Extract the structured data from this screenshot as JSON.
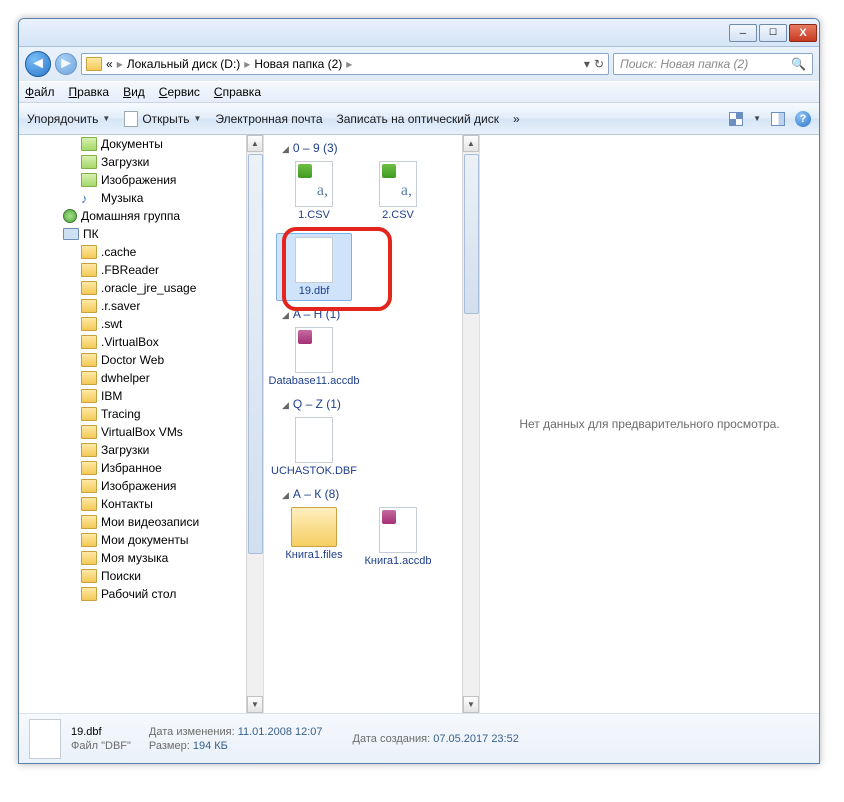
{
  "titlebar": {
    "min": "─",
    "max": "☐",
    "close": "X"
  },
  "address": {
    "back_prefix": "«",
    "crumbs": [
      "Локальный диск (D:)",
      "Новая папка (2)"
    ],
    "sep": "▸",
    "dropdown": "▾",
    "refresh": "↻"
  },
  "search": {
    "placeholder": "Поиск: Новая папка (2)"
  },
  "menu": {
    "file": "Файл",
    "edit": "Правка",
    "view": "Вид",
    "tools": "Сервис",
    "help": "Справка"
  },
  "toolbar": {
    "organize": "Упорядочить",
    "open": "Открыть",
    "email": "Электронная почта",
    "burn": "Записать на оптический диск",
    "more": "»",
    "help": "?"
  },
  "tree": {
    "items": [
      {
        "label": "Документы",
        "icon": "lib",
        "lvl": 2
      },
      {
        "label": "Загрузки",
        "icon": "lib",
        "lvl": 2
      },
      {
        "label": "Изображения",
        "icon": "lib",
        "lvl": 2
      },
      {
        "label": "Музыка",
        "icon": "music",
        "lvl": 2
      },
      {
        "label": "Домашняя группа",
        "icon": "net",
        "lvl": 1
      },
      {
        "label": "ПК",
        "icon": "pc",
        "lvl": 1
      },
      {
        "label": ".cache",
        "icon": "folder",
        "lvl": 2
      },
      {
        "label": ".FBReader",
        "icon": "folder",
        "lvl": 2
      },
      {
        "label": ".oracle_jre_usage",
        "icon": "folder",
        "lvl": 2
      },
      {
        "label": ".r.saver",
        "icon": "folder",
        "lvl": 2
      },
      {
        "label": ".swt",
        "icon": "folder",
        "lvl": 2
      },
      {
        "label": ".VirtualBox",
        "icon": "folder",
        "lvl": 2
      },
      {
        "label": "Doctor Web",
        "icon": "folder",
        "lvl": 2
      },
      {
        "label": "dwhelper",
        "icon": "folder",
        "lvl": 2
      },
      {
        "label": "IBM",
        "icon": "folder",
        "lvl": 2
      },
      {
        "label": "Tracing",
        "icon": "folder",
        "lvl": 2
      },
      {
        "label": "VirtualBox VMs",
        "icon": "folder",
        "lvl": 2
      },
      {
        "label": "Загрузки",
        "icon": "folder",
        "lvl": 2
      },
      {
        "label": "Избранное",
        "icon": "folder",
        "lvl": 2
      },
      {
        "label": "Изображения",
        "icon": "folder",
        "lvl": 2
      },
      {
        "label": "Контакты",
        "icon": "folder",
        "lvl": 2
      },
      {
        "label": "Мои видеозаписи",
        "icon": "folder",
        "lvl": 2
      },
      {
        "label": "Мои документы",
        "icon": "folder",
        "lvl": 2
      },
      {
        "label": "Моя музыка",
        "icon": "folder",
        "lvl": 2
      },
      {
        "label": "Поиски",
        "icon": "folder",
        "lvl": 2
      },
      {
        "label": "Рабочий стол",
        "icon": "folder",
        "lvl": 2
      }
    ]
  },
  "groups": [
    {
      "title": "0 – 9 (3)",
      "files": [
        {
          "name": "1.CSV",
          "thumb": "excel"
        },
        {
          "name": "2.CSV",
          "thumb": "excel"
        },
        {
          "name": "19.dbf",
          "thumb": "blank",
          "selected": true
        }
      ]
    },
    {
      "title": "A – H (1)",
      "files": [
        {
          "name": "Database11.accdb",
          "thumb": "access"
        }
      ]
    },
    {
      "title": "Q – Z (1)",
      "files": [
        {
          "name": "UCHASTOK.DBF",
          "thumb": "blank"
        }
      ]
    },
    {
      "title": "А – К (8)",
      "files": [
        {
          "name": "Книга1.files",
          "thumb": "folder-big"
        },
        {
          "name": "Книга1.accdb",
          "thumb": "access"
        }
      ]
    }
  ],
  "preview": {
    "empty": "Нет данных для предварительного просмотра."
  },
  "details": {
    "name": "19.dbf",
    "type": "Файл \"DBF\"",
    "mod_lbl": "Дата изменения:",
    "mod_val": "11.01.2008 12:07",
    "size_lbl": "Размер:",
    "size_val": "194 КБ",
    "created_lbl": "Дата создания:",
    "created_val": "07.05.2017 23:52"
  }
}
